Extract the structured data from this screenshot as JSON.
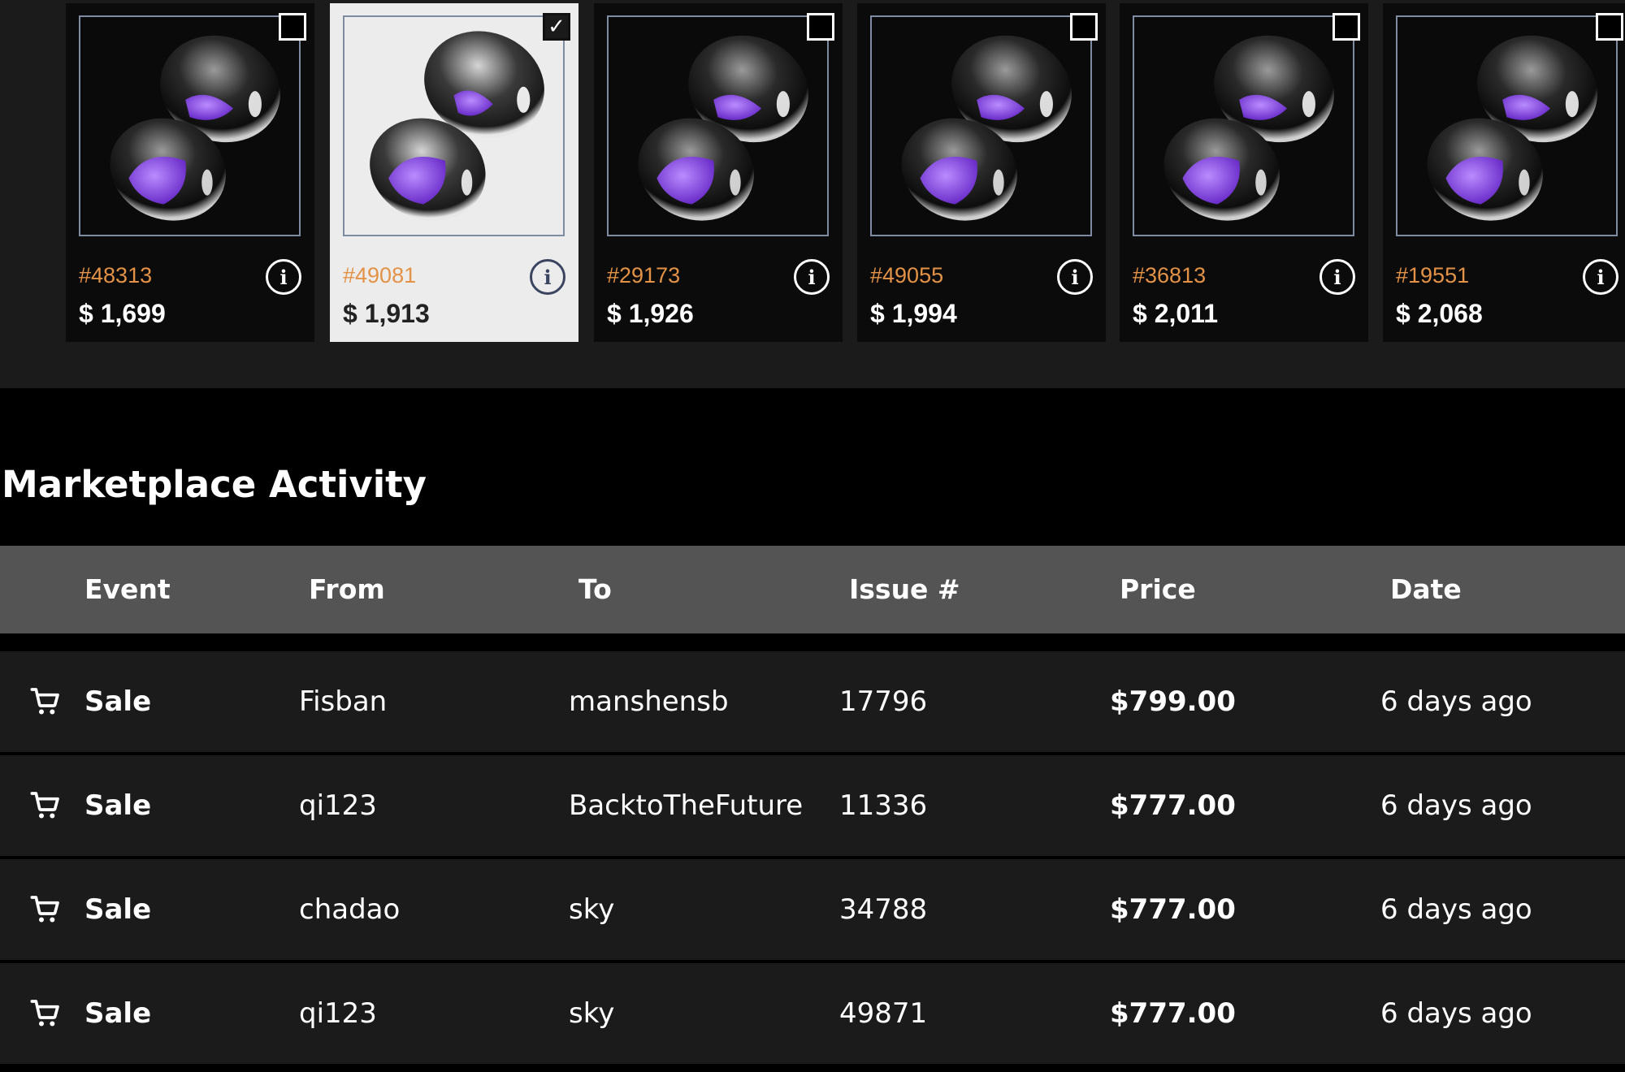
{
  "listings": [
    {
      "id": "#48313",
      "price": "$ 1,699",
      "checked": false
    },
    {
      "id": "#49081",
      "price": "$ 1,913",
      "checked": true
    },
    {
      "id": "#29173",
      "price": "$ 1,926",
      "checked": false
    },
    {
      "id": "#49055",
      "price": "$ 1,994",
      "checked": false
    },
    {
      "id": "#36813",
      "price": "$ 2,011",
      "checked": false
    },
    {
      "id": "#19551",
      "price": "$ 2,068",
      "checked": false
    }
  ],
  "checkmark": "✓",
  "info_glyph": "i",
  "activity": {
    "title": "Marketplace Activity",
    "columns": [
      "Event",
      "From",
      "To",
      "Issue #",
      "Price",
      "Date"
    ],
    "rows": [
      {
        "event": "Sale",
        "from": "Fisban",
        "to": "manshensb",
        "issue": "17796",
        "price": "$799.00",
        "date": "6 days ago"
      },
      {
        "event": "Sale",
        "from": "qi123",
        "to": "BacktoTheFuture",
        "issue": "11336",
        "price": "$777.00",
        "date": "6 days ago"
      },
      {
        "event": "Sale",
        "from": "chadao",
        "to": "sky",
        "issue": "34788",
        "price": "$777.00",
        "date": "6 days ago"
      },
      {
        "event": "Sale",
        "from": "qi123",
        "to": "sky",
        "issue": "49871",
        "price": "$777.00",
        "date": "6 days ago"
      }
    ]
  },
  "colors": {
    "accent_id": "#e39246",
    "selected_card": "#ececec",
    "table_header": "#545454",
    "row_bg": "#1b1b1b"
  },
  "icons": {
    "row_event": "shopping-cart-icon",
    "card_info": "info-icon"
  }
}
